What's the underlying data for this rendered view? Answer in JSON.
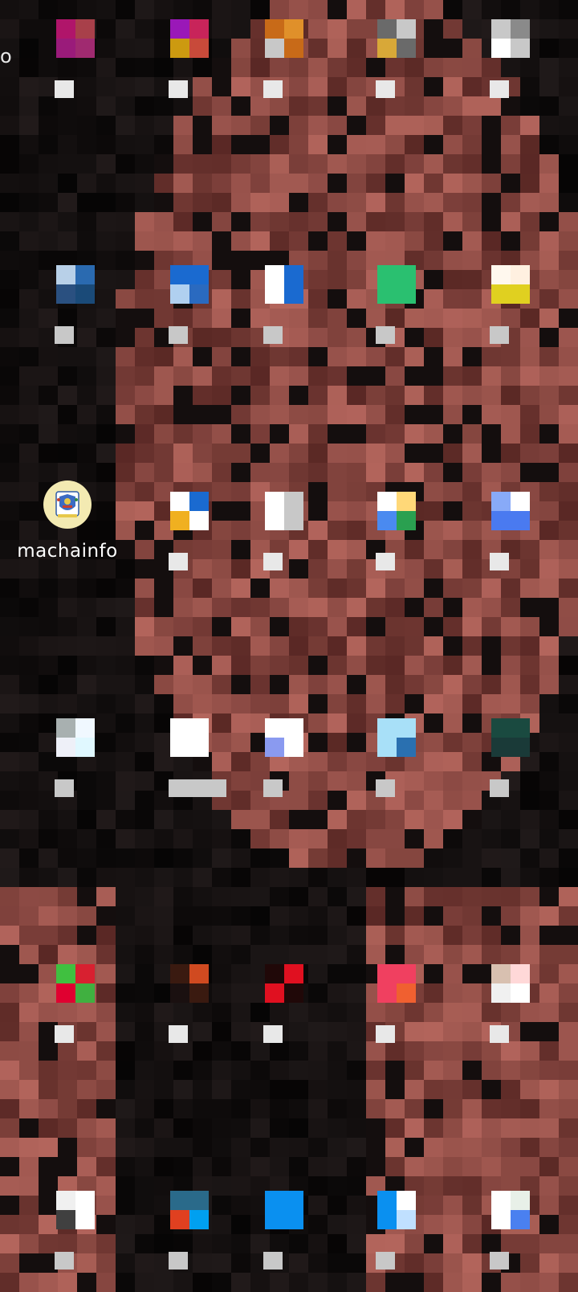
{
  "status_bar": {
    "left_fragment": "o"
  },
  "home_screen": {
    "apps": [
      {
        "label": "machainfo",
        "icon": "machainfo-crest-icon",
        "icon_bg": "#f3eab2"
      }
    ]
  },
  "colors": {
    "background": "#050505",
    "label_text": "#ffffff"
  }
}
